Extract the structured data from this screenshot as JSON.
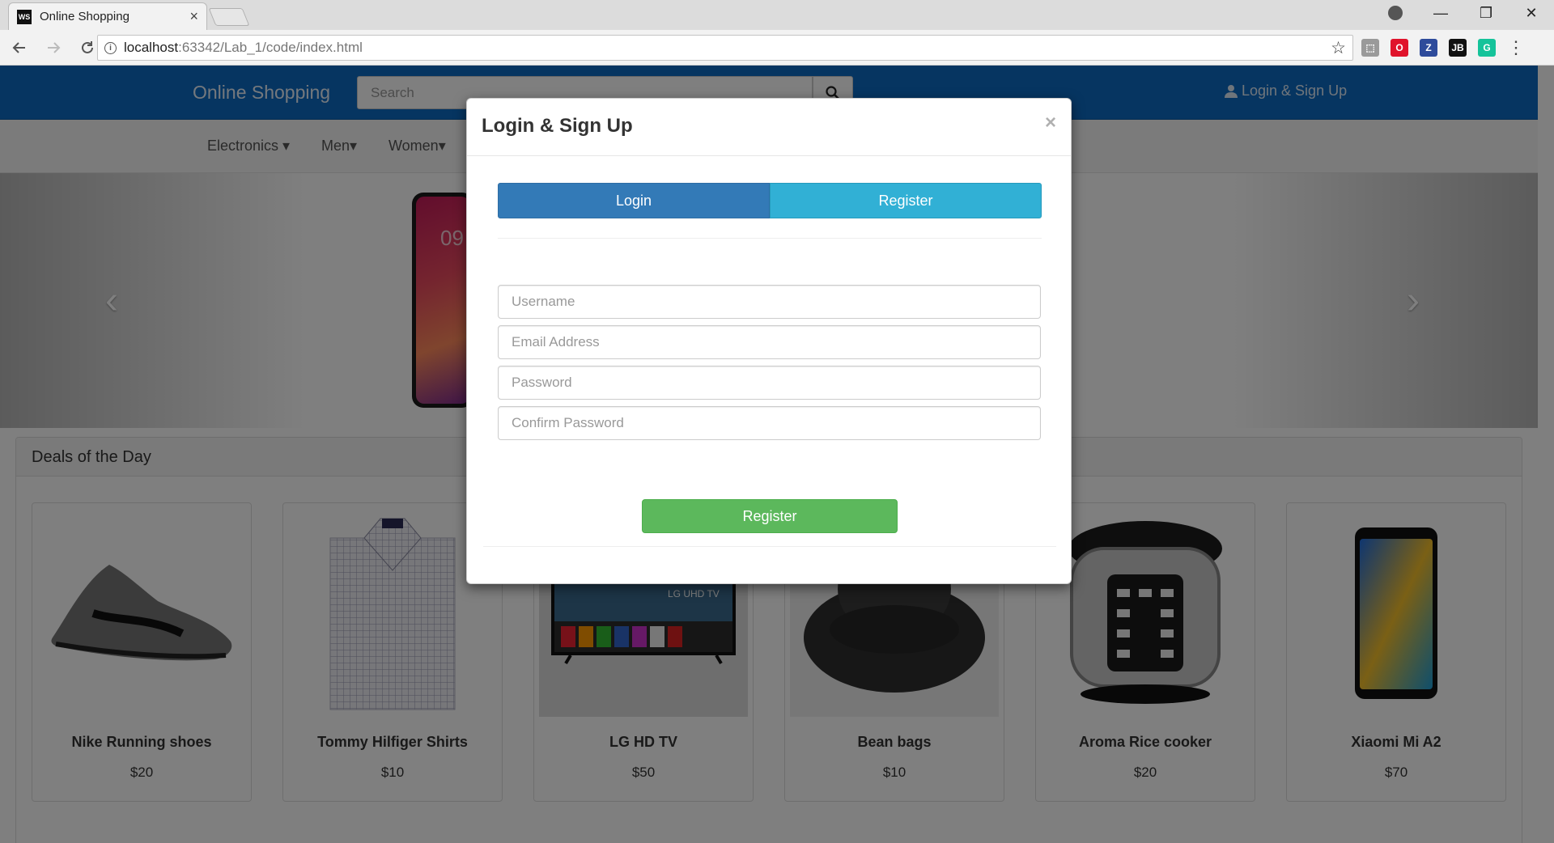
{
  "browser": {
    "tab_title": "Online Shopping",
    "tab_favicon": "WS",
    "tab_close": "×",
    "url_host": "localhost",
    "url_path": ":63342/Lab_1/code/index.html",
    "window_minimize": "—",
    "window_restore": "❐",
    "window_close": "✕",
    "extensions": [
      {
        "name": "acrobat-icon",
        "label": "⬚",
        "color": "#9a9a9a"
      },
      {
        "name": "opera-icon",
        "label": "O",
        "color": "#e0132b"
      },
      {
        "name": "zotero-icon",
        "label": "Z",
        "color": "#2e4b9b"
      },
      {
        "name": "jetbrains-icon",
        "label": "JB",
        "color": "#111111"
      },
      {
        "name": "grammarly-icon",
        "label": "G",
        "color": "#15c39a"
      }
    ]
  },
  "navbar": {
    "brand": "Online Shopping",
    "search_placeholder": "Search",
    "user_link": "Login & Sign Up",
    "color": "#0d6bc2"
  },
  "categories": [
    {
      "label": "Electronics",
      "caret": "▾"
    },
    {
      "label": "Men",
      "caret": "▾"
    },
    {
      "label": "Women",
      "caret": "▾"
    }
  ],
  "carousel": {
    "phone_time": "09",
    "prev": "‹",
    "next": "›"
  },
  "deals": {
    "heading": "Deals of the Day",
    "products": [
      {
        "name": "Nike Running shoes",
        "price": "$20"
      },
      {
        "name": "Tommy Hilfiger Shirts",
        "price": "$10"
      },
      {
        "name": "LG HD TV",
        "price": "$50"
      },
      {
        "name": "Bean bags",
        "price": "$10"
      },
      {
        "name": "Aroma Rice cooker",
        "price": "$20"
      },
      {
        "name": "Xiaomi Mi A2",
        "price": "$70"
      }
    ]
  },
  "modal": {
    "title": "Login & Sign Up",
    "close": "×",
    "tab_login": "Login",
    "tab_register": "Register",
    "fields": {
      "username": "Username",
      "email": "Email Address",
      "password": "Password",
      "confirm": "Confirm Password"
    },
    "submit": "Register",
    "colors": {
      "login_tab": "#337ab7",
      "register_tab": "#31b0d5",
      "submit": "#5cb85c"
    }
  }
}
